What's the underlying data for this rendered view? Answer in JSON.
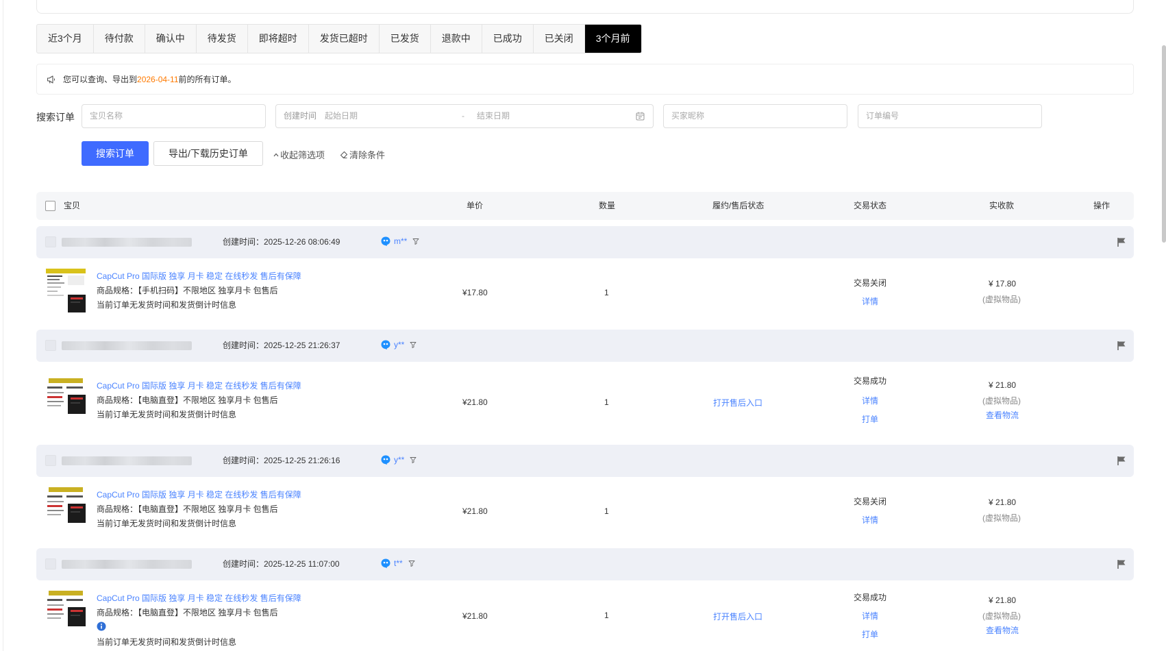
{
  "tabs": [
    {
      "label": "近3个月",
      "active": false
    },
    {
      "label": "待付款",
      "active": false
    },
    {
      "label": "确认中",
      "active": false
    },
    {
      "label": "待发货",
      "active": false
    },
    {
      "label": "即将超时",
      "active": false
    },
    {
      "label": "发货已超时",
      "active": false
    },
    {
      "label": "已发货",
      "active": false
    },
    {
      "label": "退款中",
      "active": false
    },
    {
      "label": "已成功",
      "active": false
    },
    {
      "label": "已关闭",
      "active": false
    },
    {
      "label": "3个月前",
      "active": true
    }
  ],
  "notice": {
    "prefix": "您可以查询、导出到 ",
    "date": "2026-04-11",
    "suffix": " 前的所有订单。"
  },
  "search": {
    "label": "搜索订单",
    "item_placeholder": "宝贝名称",
    "date_label": "创建时间",
    "start_placeholder": "起始日期",
    "separator": "-",
    "end_placeholder": "结束日期",
    "buyer_placeholder": "买家昵称",
    "order_placeholder": "订单编号",
    "search_button": "搜索订单",
    "export_button": "导出/下载历史订单",
    "collapse_link": "收起筛选项",
    "clear_link": "清除条件"
  },
  "table_header": {
    "item": "宝贝",
    "unit_price": "单价",
    "quantity": "数量",
    "fulfillment": "履约/售后状态",
    "trade_status": "交易状态",
    "received": "实收款",
    "actions": "操作"
  },
  "orders": [
    {
      "created": "创建时间：2025-12-26 08:06:49",
      "buyer": "m**",
      "title": "CapCut Pro 国际版 独享 月卡 稳定 在线秒发 售后有保障",
      "spec": "商品规格：【手机扫码】不限地区 独享月卡 包售后",
      "note": "当前订单无发货时间和发货倒计时信息",
      "price": "¥17.80",
      "qty": "1",
      "after_sale": "",
      "status": "交易关闭",
      "detail": "详情",
      "print": "",
      "amount": "¥ 17.80",
      "virtual": "(虚拟物品)",
      "logistics": ""
    },
    {
      "created": "创建时间：2025-12-25 21:26:37",
      "buyer": "y**",
      "title": "CapCut Pro 国际版 独享 月卡 稳定 在线秒发 售后有保障",
      "spec": "商品规格：【电脑直登】不限地区 独享月卡 包售后",
      "note": "当前订单无发货时间和发货倒计时信息",
      "price": "¥21.80",
      "qty": "1",
      "after_sale": "打开售后入口",
      "status": "交易成功",
      "detail": "详情",
      "print": "打单",
      "amount": "¥ 21.80",
      "virtual": "(虚拟物品)",
      "logistics": "查看物流"
    },
    {
      "created": "创建时间：2025-12-25 21:26:16",
      "buyer": "y**",
      "title": "CapCut Pro 国际版 独享 月卡 稳定 在线秒发 售后有保障",
      "spec": "商品规格：【电脑直登】不限地区 独享月卡 包售后",
      "note": "当前订单无发货时间和发货倒计时信息",
      "price": "¥21.80",
      "qty": "1",
      "after_sale": "",
      "status": "交易关闭",
      "detail": "详情",
      "print": "",
      "amount": "¥ 21.80",
      "virtual": "(虚拟物品)",
      "logistics": ""
    },
    {
      "created": "创建时间：2025-12-25 11:07:00",
      "buyer": "t**",
      "title": "CapCut Pro 国际版 独享 月卡 稳定 在线秒发 售后有保障",
      "spec": "商品规格：【电脑直登】不限地区 独享月卡 包售后",
      "note": "当前订单无发货时间和发货倒计时信息",
      "price": "¥21.80",
      "qty": "1",
      "after_sale": "打开售后入口",
      "status": "交易成功",
      "detail": "详情",
      "print": "打单",
      "amount": "¥ 21.80",
      "virtual": "(虚拟物品)",
      "logistics": "查看物流"
    }
  ]
}
